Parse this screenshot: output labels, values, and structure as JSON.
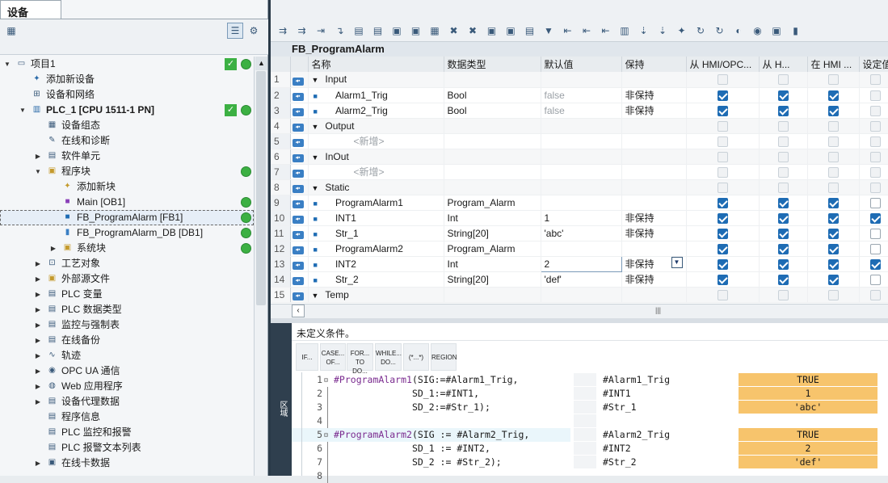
{
  "left_panel": {
    "tab": "设备",
    "tree": [
      {
        "label": "项目1",
        "level": 0,
        "arrow": "down",
        "icon": "project-icon",
        "check": true,
        "dot": true
      },
      {
        "label": "添加新设备",
        "level": 1,
        "arrow": "",
        "icon": "add-device-icon"
      },
      {
        "label": "设备和网络",
        "level": 1,
        "arrow": "",
        "icon": "network-icon"
      },
      {
        "label": "PLC_1 [CPU 1511-1 PN]",
        "level": 1,
        "arrow": "down",
        "icon": "plc-icon",
        "check": true,
        "dot": true,
        "bold": true
      },
      {
        "label": "设备组态",
        "level": 2,
        "arrow": "",
        "icon": "device-config-icon"
      },
      {
        "label": "在线和诊断",
        "level": 2,
        "arrow": "",
        "icon": "diagnostics-icon"
      },
      {
        "label": "软件单元",
        "level": 2,
        "arrow": "right",
        "icon": "software-unit-icon"
      },
      {
        "label": "程序块",
        "level": 2,
        "arrow": "down",
        "icon": "folder-icon",
        "dot": true
      },
      {
        "label": "添加新块",
        "level": 3,
        "arrow": "",
        "icon": "add-block-icon"
      },
      {
        "label": "Main [OB1]",
        "level": 3,
        "arrow": "",
        "icon": "ob-icon",
        "dot": true
      },
      {
        "label": "FB_ProgramAlarm [FB1]",
        "level": 3,
        "arrow": "",
        "icon": "fb-icon",
        "dot": true,
        "selected": true
      },
      {
        "label": "FB_ProgramAlarm_DB [DB1]",
        "level": 3,
        "arrow": "",
        "icon": "db-icon",
        "dot": true
      },
      {
        "label": "系统块",
        "level": 3,
        "arrow": "right",
        "icon": "folder-icon",
        "dot": true
      },
      {
        "label": "工艺对象",
        "level": 2,
        "arrow": "right",
        "icon": "tech-object-icon"
      },
      {
        "label": "外部源文件",
        "level": 2,
        "arrow": "right",
        "icon": "folder-icon"
      },
      {
        "label": "PLC 变量",
        "level": 2,
        "arrow": "right",
        "icon": "tag-icon"
      },
      {
        "label": "PLC 数据类型",
        "level": 2,
        "arrow": "right",
        "icon": "datatype-icon"
      },
      {
        "label": "监控与强制表",
        "level": 2,
        "arrow": "right",
        "icon": "watch-table-icon"
      },
      {
        "label": "在线备份",
        "level": 2,
        "arrow": "right",
        "icon": "backup-icon"
      },
      {
        "label": "轨迹",
        "level": 2,
        "arrow": "right",
        "icon": "trace-icon"
      },
      {
        "label": "OPC UA 通信",
        "level": 2,
        "arrow": "right",
        "icon": "opcua-icon"
      },
      {
        "label": "Web 应用程序",
        "level": 2,
        "arrow": "right",
        "icon": "web-icon"
      },
      {
        "label": "设备代理数据",
        "level": 2,
        "arrow": "right",
        "icon": "proxy-icon"
      },
      {
        "label": "程序信息",
        "level": 2,
        "arrow": "",
        "icon": "program-info-icon"
      },
      {
        "label": "PLC 监控和报警",
        "level": 2,
        "arrow": "",
        "icon": "alarm-icon"
      },
      {
        "label": "PLC 报警文本列表",
        "level": 2,
        "arrow": "",
        "icon": "text-list-icon"
      },
      {
        "label": "在线卡数据",
        "level": 2,
        "arrow": "right",
        "icon": "card-icon"
      }
    ]
  },
  "editor": {
    "block_title": "FB_ProgramAlarm",
    "columns": [
      "名称",
      "数据类型",
      "默认值",
      "保持",
      "从 HMI/OPC...",
      "从 H...",
      "在 HMI ...",
      "设定值"
    ],
    "rows": [
      {
        "n": "1",
        "section": true,
        "name": "Input",
        "type": "",
        "def": "",
        "ret": "",
        "c": [
          0,
          0,
          0,
          0
        ],
        "dis": [
          1,
          1,
          1,
          1
        ]
      },
      {
        "n": "2",
        "name": "Alarm1_Trig",
        "type": "Bool",
        "def": "false",
        "defgray": true,
        "ret": "非保持",
        "c": [
          1,
          1,
          1,
          0
        ],
        "dis": [
          0,
          0,
          0,
          1
        ]
      },
      {
        "n": "3",
        "name": "Alarm2_Trig",
        "type": "Bool",
        "def": "false",
        "defgray": true,
        "ret": "非保持",
        "c": [
          1,
          1,
          1,
          0
        ],
        "dis": [
          0,
          0,
          0,
          1
        ]
      },
      {
        "n": "4",
        "section": true,
        "name": "Output",
        "type": "",
        "def": "",
        "ret": "",
        "c": [
          0,
          0,
          0,
          0
        ],
        "dis": [
          1,
          1,
          1,
          1
        ]
      },
      {
        "n": "5",
        "add": true,
        "name": "<新增>",
        "type": "",
        "def": "",
        "ret": "",
        "c": [
          0,
          0,
          0,
          0
        ],
        "dis": [
          1,
          1,
          1,
          1
        ]
      },
      {
        "n": "6",
        "section": true,
        "name": "InOut",
        "type": "",
        "def": "",
        "ret": "",
        "c": [
          0,
          0,
          0,
          0
        ],
        "dis": [
          1,
          1,
          1,
          1
        ]
      },
      {
        "n": "7",
        "add": true,
        "name": "<新增>",
        "type": "",
        "def": "",
        "ret": "",
        "c": [
          0,
          0,
          0,
          0
        ],
        "dis": [
          1,
          1,
          1,
          1
        ]
      },
      {
        "n": "8",
        "section": true,
        "name": "Static",
        "type": "",
        "def": "",
        "ret": "",
        "c": [
          0,
          0,
          0,
          0
        ],
        "dis": [
          1,
          1,
          1,
          1
        ]
      },
      {
        "n": "9",
        "name": "ProgramAlarm1",
        "type": "Program_Alarm",
        "def": "",
        "ret": "",
        "c": [
          1,
          1,
          1,
          0
        ],
        "dis": [
          0,
          0,
          0,
          0
        ]
      },
      {
        "n": "10",
        "name": "INT1",
        "type": "Int",
        "def": "1",
        "ret": "非保持",
        "c": [
          1,
          1,
          1,
          1
        ],
        "dis": [
          0,
          0,
          0,
          0
        ]
      },
      {
        "n": "11",
        "name": "Str_1",
        "type": "String[20]",
        "def": "'abc'",
        "ret": "非保持",
        "c": [
          1,
          1,
          1,
          0
        ],
        "dis": [
          0,
          0,
          0,
          0
        ]
      },
      {
        "n": "12",
        "name": "ProgramAlarm2",
        "type": "Program_Alarm",
        "def": "",
        "ret": "",
        "c": [
          1,
          1,
          1,
          0
        ],
        "dis": [
          0,
          0,
          0,
          0
        ]
      },
      {
        "n": "13",
        "name": "INT2",
        "type": "Int",
        "def": "2",
        "ret": "非保持",
        "c": [
          1,
          1,
          1,
          1
        ],
        "dis": [
          0,
          0,
          0,
          0
        ],
        "editing": true
      },
      {
        "n": "14",
        "name": "Str_2",
        "type": "String[20]",
        "def": "'def'",
        "ret": "非保持",
        "c": [
          1,
          1,
          1,
          0
        ],
        "dis": [
          0,
          0,
          0,
          0
        ]
      },
      {
        "n": "15",
        "section": true,
        "name": "Temp",
        "type": "",
        "def": "",
        "ret": "",
        "c": [
          0,
          0,
          0,
          0
        ],
        "dis": [
          1,
          1,
          1,
          1
        ]
      }
    ]
  },
  "lower": {
    "condition_text": "未定义条件。",
    "sidebar_label": "区域",
    "snippets": [
      "IF...",
      "CASE... OF...",
      "FOR... TO DO...",
      "WHILE... DO...",
      "(*...*)",
      "REGION"
    ],
    "code": [
      {
        "ln": "1",
        "pre": "",
        "var": "#ProgramAlarm1",
        "rest": "(SIG:=#Alarm1_Trig,",
        "fold": true
      },
      {
        "ln": "2",
        "pre": "              ",
        "var": "",
        "rest": "SD_1:=#INT1,"
      },
      {
        "ln": "3",
        "pre": "              ",
        "var": "",
        "rest": "SD_2:=#Str_1);"
      },
      {
        "ln": "4",
        "pre": "",
        "var": "",
        "rest": ""
      },
      {
        "ln": "5",
        "pre": "",
        "var": "#ProgramAlarm2",
        "rest": "(SIG := #Alarm2_Trig,",
        "fold": true,
        "hl": true
      },
      {
        "ln": "6",
        "pre": "              ",
        "var": "",
        "rest": "SD_1 := #INT2,"
      },
      {
        "ln": "7",
        "pre": "              ",
        "var": "",
        "rest": "SD_2 := #Str_2);"
      },
      {
        "ln": "8",
        "pre": "",
        "var": "",
        "rest": ""
      }
    ],
    "watch": [
      {
        "name": "#Alarm1_Trig",
        "value": "TRUE"
      },
      {
        "name": "#INT1",
        "value": "1"
      },
      {
        "name": "#Str_1",
        "value": "'abc'"
      },
      {
        "name": "",
        "value": ""
      },
      {
        "name": "#Alarm2_Trig",
        "value": "TRUE"
      },
      {
        "name": "#INT2",
        "value": "2"
      },
      {
        "name": "#Str_2",
        "value": "'def'"
      }
    ]
  }
}
